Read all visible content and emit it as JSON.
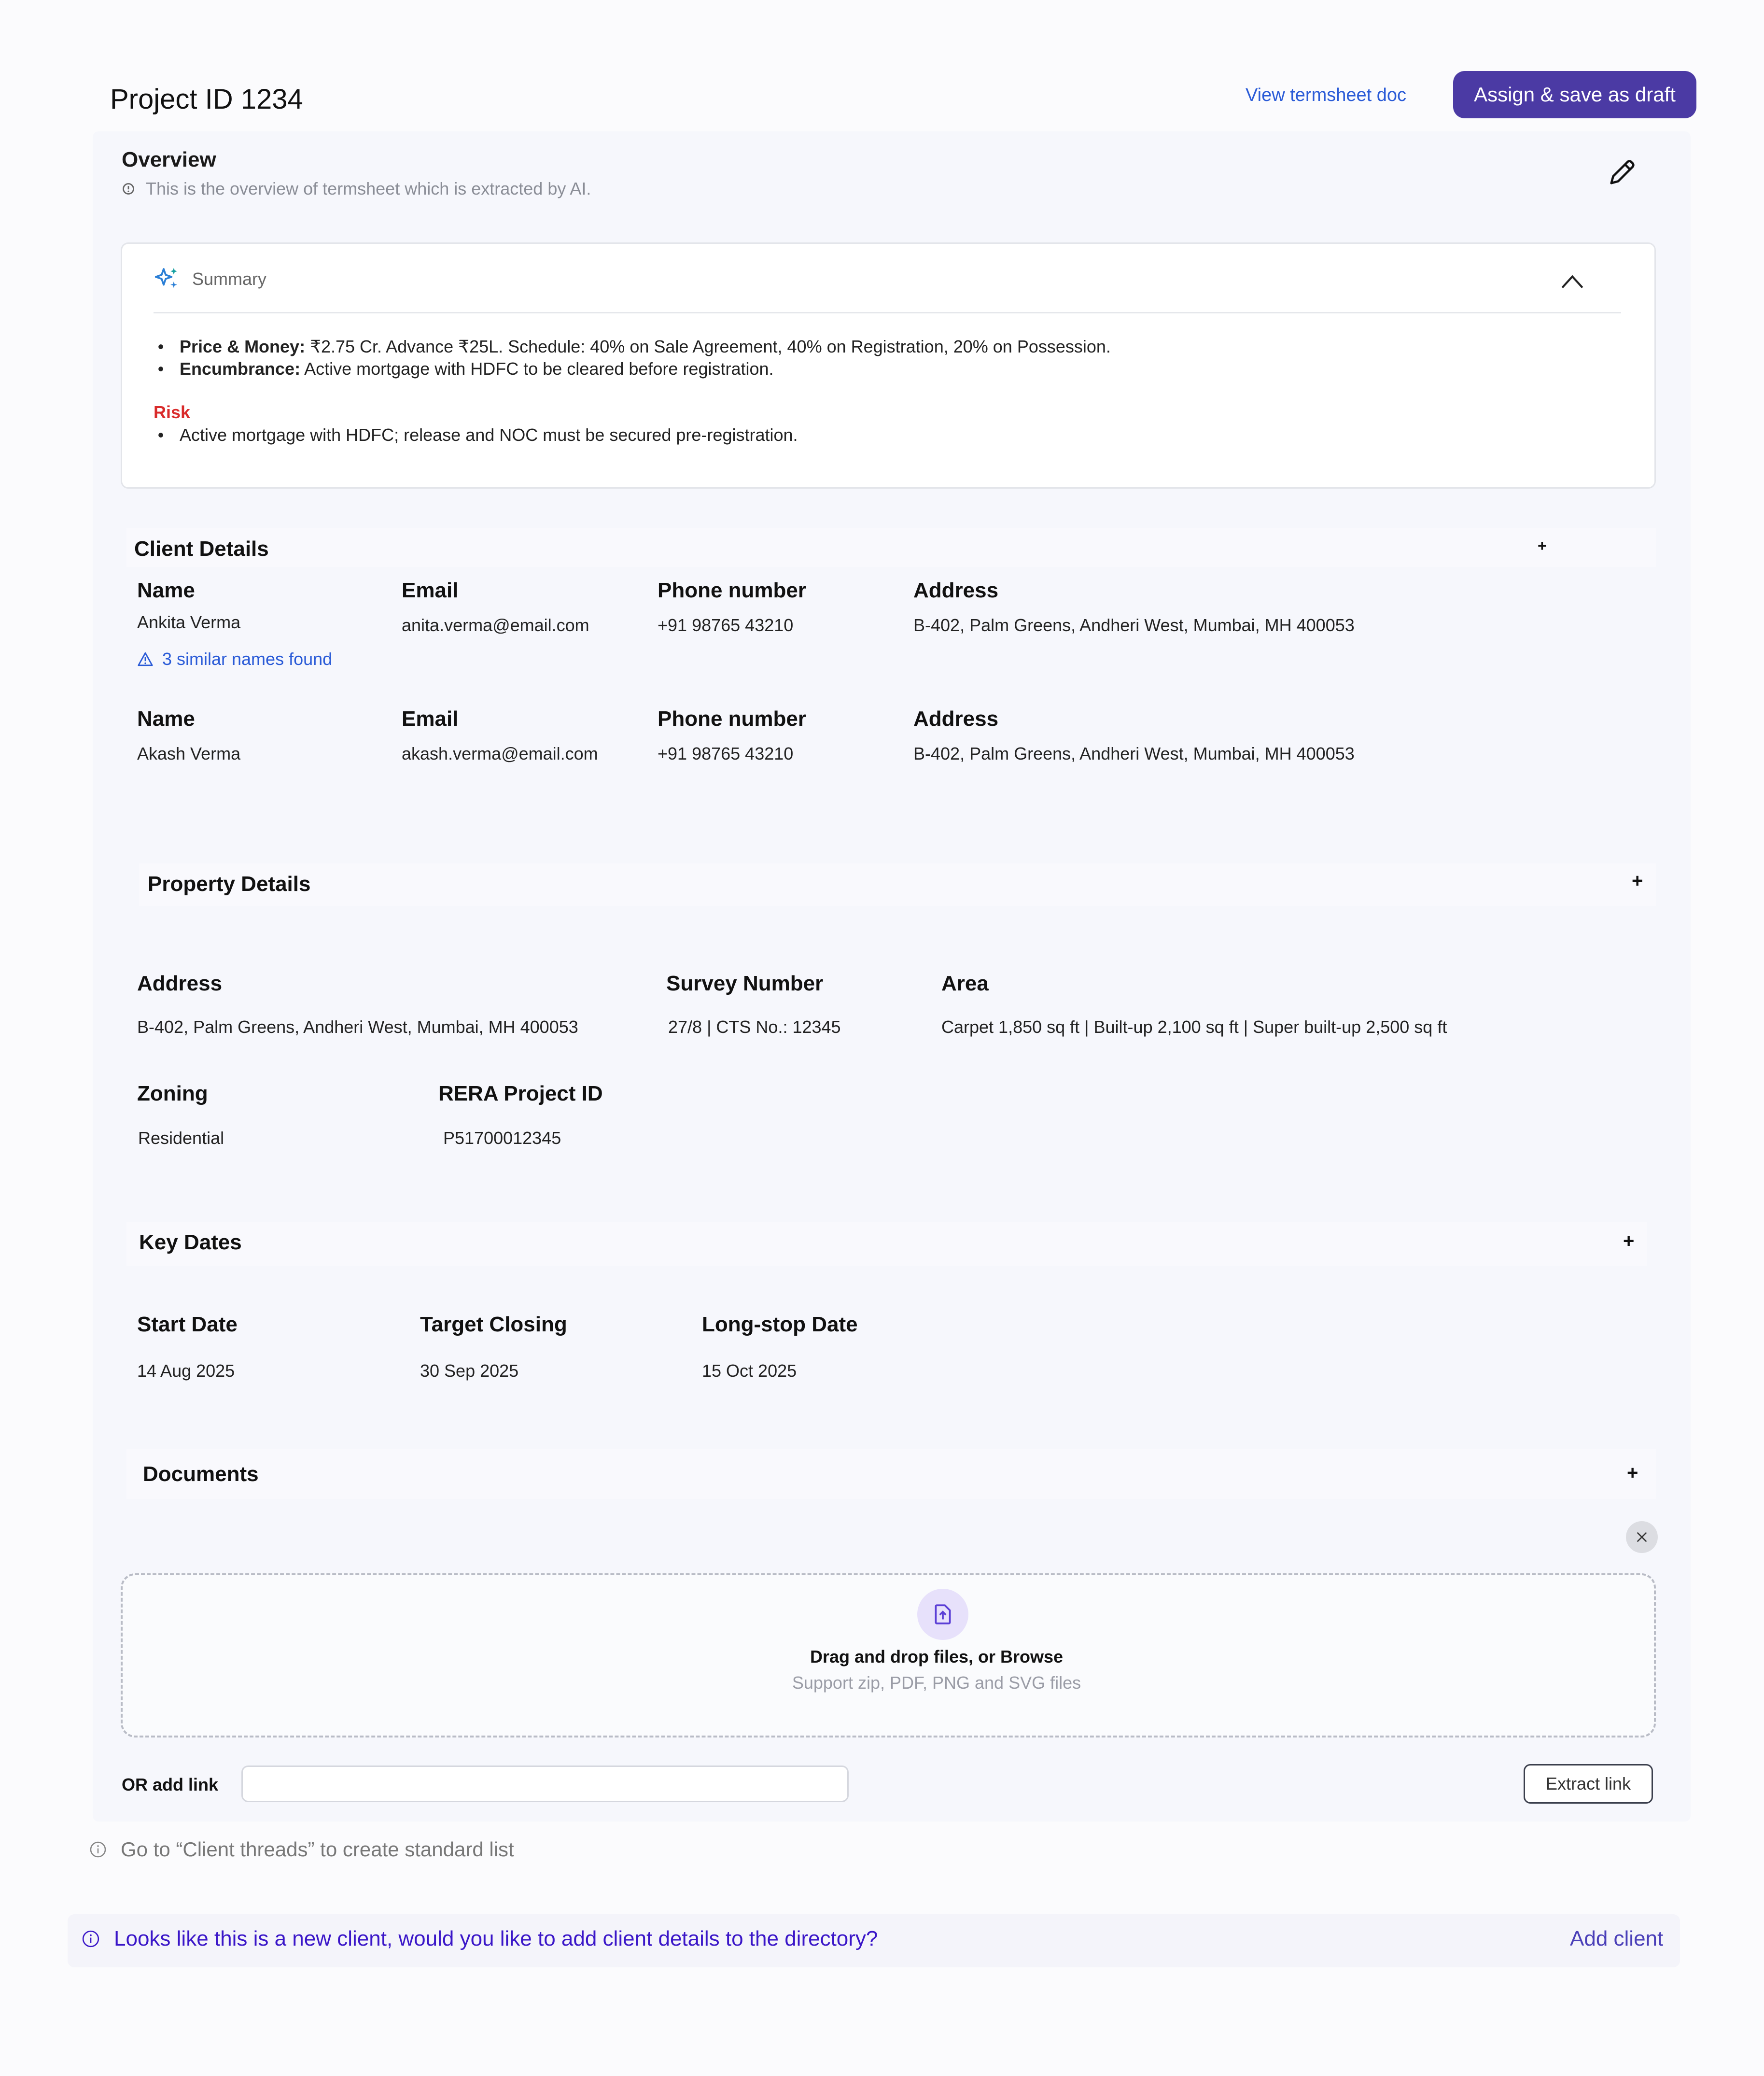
{
  "header": {
    "title": "Project ID 1234",
    "view_doc": "View termsheet doc",
    "primary_button": "Assign & save as draft"
  },
  "overview": {
    "title": "Overview",
    "description": "This is the overview of termsheet which is extracted by AI."
  },
  "summary": {
    "title": "Summary",
    "items": [
      {
        "label": "Price & Money:",
        "text": " ₹2.75 Cr. Advance ₹25L. Schedule: 40% on Sale Agreement, 40% on Registration, 20% on Possession."
      },
      {
        "label": "Encumbrance:",
        "text": " Active mortgage with HDFC to be cleared before registration."
      }
    ],
    "risk_label": "Risk",
    "risks": [
      "Active mortgage with HDFC; release and NOC must be secured pre-registration."
    ]
  },
  "client_details": {
    "title": "Client Details",
    "plus": "+",
    "labels": {
      "name": "Name",
      "email": "Email",
      "phone": "Phone number",
      "address": "Address"
    },
    "clients": [
      {
        "name": "Ankita Verma",
        "email": "anita.verma@email.com",
        "phone": "+91 98765 43210",
        "address": "B-402, Palm Greens, Andheri West, Mumbai, MH 400053",
        "warning": "3 similar names found"
      },
      {
        "name": "Akash Verma",
        "email": "akash.verma@email.com",
        "phone": "+91 98765 43210",
        "address": "B-402, Palm Greens, Andheri West, Mumbai, MH 400053"
      }
    ]
  },
  "property_details": {
    "title": "Property Details",
    "plus": "+",
    "address_label": "Address",
    "address": "B-402, Palm Greens, Andheri West, Mumbai, MH 400053",
    "survey_label": "Survey Number",
    "survey": "27/8 | CTS No.: 12345",
    "area_label": "Area",
    "area": "Carpet 1,850 sq ft | Built-up 2,100 sq ft | Super built-up 2,500 sq ft",
    "zoning_label": "Zoning",
    "zoning": "Residential",
    "rera_label": "RERA Project ID",
    "rera": "P51700012345"
  },
  "key_dates": {
    "title": "Key Dates",
    "plus": "+",
    "start_label": "Start Date",
    "start": "14 Aug 2025",
    "target_label": "Target Closing",
    "target": "30 Sep 2025",
    "longstop_label": "Long-stop Date",
    "longstop": "15 Oct 2025"
  },
  "documents": {
    "title": "Documents",
    "plus": "+",
    "drop_title": "Drag and drop files, or Browse",
    "drop_subtitle": "Support zip, PDF, PNG and SVG files",
    "or_label": "OR add link",
    "link_value": "",
    "extract_button": "Extract link"
  },
  "notes": {
    "goto": "Go to “Client threads” to create standard list",
    "new_client": "Looks like this is a new client, would you like to add client details to the directory?",
    "add_client": "Add client"
  },
  "colors": {
    "primary": "#4b3aa4",
    "link": "#2a5bd7",
    "risk": "#d92b2b",
    "new_client_text": "#3a16c8"
  }
}
